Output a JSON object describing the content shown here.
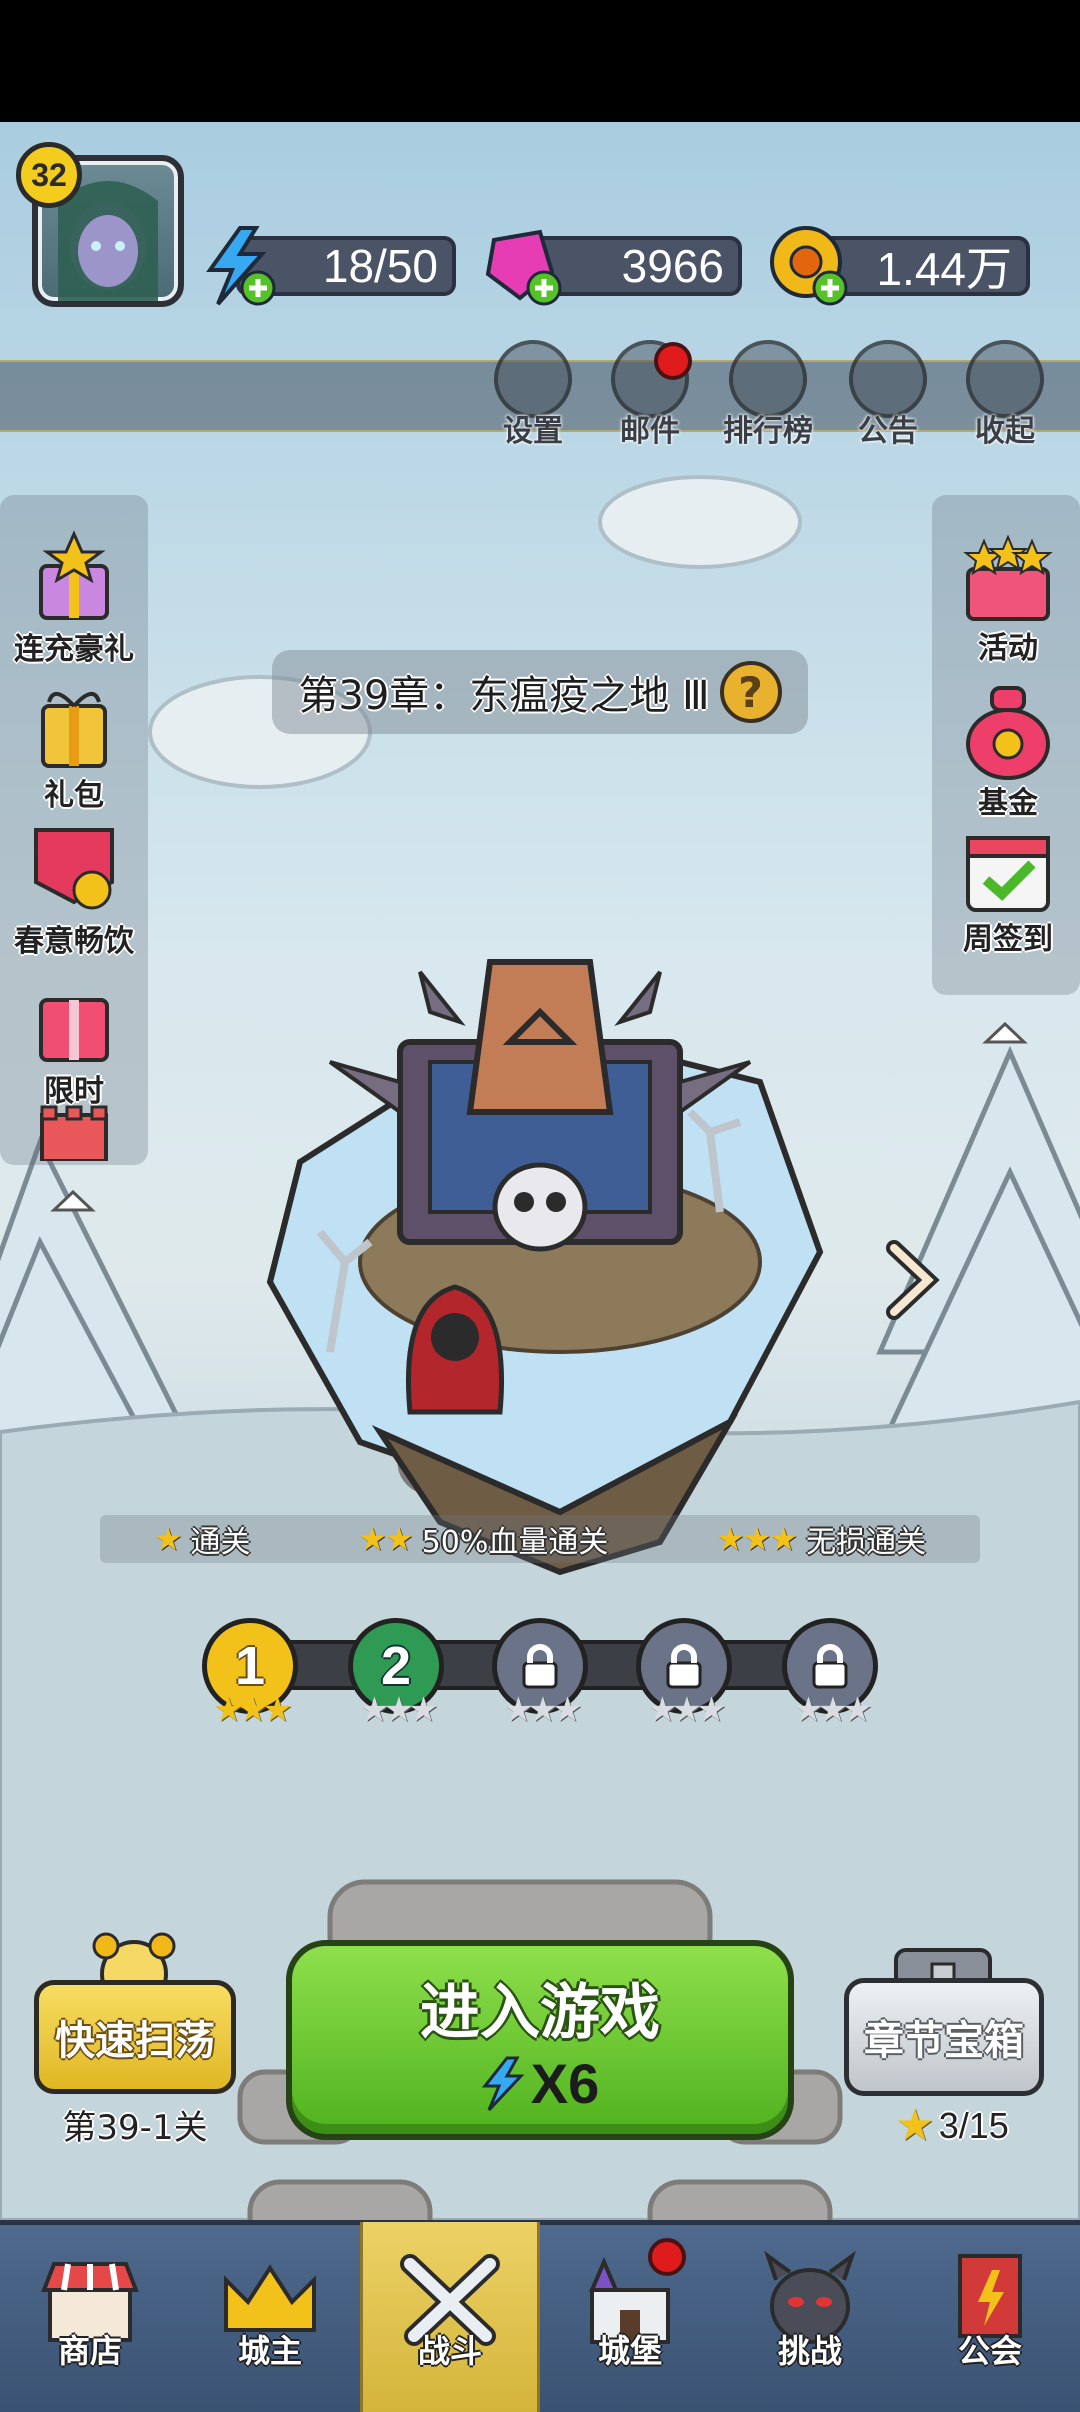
{
  "player": {
    "level": "32"
  },
  "resources": {
    "energy": "18/50",
    "gems": "3966",
    "gold": "1.44万"
  },
  "top_menu": [
    {
      "label": "设置",
      "icon": "gear-icon"
    },
    {
      "label": "邮件",
      "icon": "mail-icon",
      "badge": true
    },
    {
      "label": "排行榜",
      "icon": "ranking-icon"
    },
    {
      "label": "公告",
      "icon": "megaphone-icon"
    },
    {
      "label": "收起",
      "icon": "play-icon"
    }
  ],
  "left_panel": [
    {
      "label": "连充豪礼",
      "icon": "gift-star-icon"
    },
    {
      "label": "礼包",
      "icon": "gift-box-icon"
    },
    {
      "label": "春意畅饮",
      "icon": "spring-drink-icon"
    },
    {
      "label": "限时",
      "icon": "limited-gift-icon"
    }
  ],
  "right_panel": [
    {
      "label": "活动",
      "icon": "event-chest-icon"
    },
    {
      "label": "基金",
      "icon": "money-bag-icon"
    },
    {
      "label": "周签到",
      "icon": "calendar-check-icon"
    }
  ],
  "chapter": {
    "title": "第39章：东瘟疫之地 Ⅲ",
    "help": "?"
  },
  "conditions": [
    {
      "stars": "★",
      "label": "通关"
    },
    {
      "stars": "★★",
      "label": "50%血量通关"
    },
    {
      "stars": "★★★",
      "label": "无损通关"
    }
  ],
  "stages": [
    {
      "number": "1",
      "state": "cleared",
      "stars_earned": 3
    },
    {
      "number": "2",
      "state": "current",
      "stars_earned": 0
    },
    {
      "number": "",
      "state": "locked",
      "stars_earned": 0
    },
    {
      "number": "",
      "state": "locked",
      "stars_earned": 0
    },
    {
      "number": "",
      "state": "locked",
      "stars_earned": 0
    }
  ],
  "actions": {
    "sweep_label": "快速扫荡",
    "sweep_stage": "第39-1关",
    "enter_label": "进入游戏",
    "enter_cost": "X6",
    "chest_label": "章节宝箱",
    "chest_progress": "3/15"
  },
  "bottom_nav": [
    {
      "label": "商店",
      "icon": "shop-icon"
    },
    {
      "label": "城主",
      "icon": "crown-icon"
    },
    {
      "label": "战斗",
      "icon": "crossed-swords-icon",
      "active": true
    },
    {
      "label": "城堡",
      "icon": "castle-icon",
      "badge": true
    },
    {
      "label": "挑战",
      "icon": "demon-icon"
    },
    {
      "label": "公会",
      "icon": "guild-banner-icon"
    }
  ],
  "colors": {
    "accent_green": "#5cc028",
    "gold": "#f2c21b",
    "nav_bg": "#4f6a8e"
  }
}
